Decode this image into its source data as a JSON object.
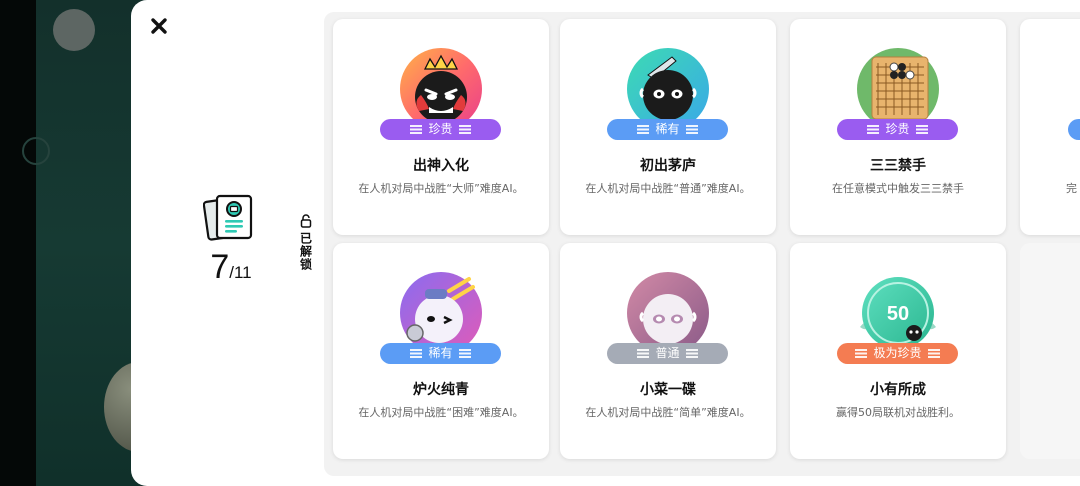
{
  "summary": {
    "unlocked": "7",
    "total": "/11"
  },
  "unlock_label": "已解锁",
  "colors": {
    "precious": "#9a5cf0",
    "rare": "#5b9cf5",
    "common": "#a5abb6",
    "very_precious": "#f47c52"
  },
  "cards": [
    {
      "title": "出神入化",
      "desc": "在人机对局中战胜“大师”难度AI。",
      "rarity": "珍贵",
      "icon": "crowned-master-bot-badge"
    },
    {
      "title": "初出茅庐",
      "desc": "在人机对局中战胜“普通”难度AI。",
      "rarity": "稀有",
      "icon": "sword-bot-badge"
    },
    {
      "title": "三三禁手",
      "desc": "在任意模式中触发三三禁手",
      "rarity": "珍贵",
      "icon": "gomoku-board-badge"
    },
    {
      "title": "炉火纯青",
      "desc": "在人机对局中战胜“困难”难度AI。",
      "rarity": "稀有",
      "icon": "winking-bot-badge"
    },
    {
      "title": "小菜一碟",
      "desc": "在人机对局中战胜“简单”难度AI。",
      "rarity": "普通",
      "icon": "simple-bot-badge"
    },
    {
      "title": "小有所成",
      "desc": "赢得50局联机对战胜利。",
      "rarity": "极为珍贵",
      "icon": "fifty-wins-badge",
      "badge_number": "50"
    },
    {
      "title": "",
      "desc": "完",
      "rarity": "",
      "icon": ""
    }
  ]
}
